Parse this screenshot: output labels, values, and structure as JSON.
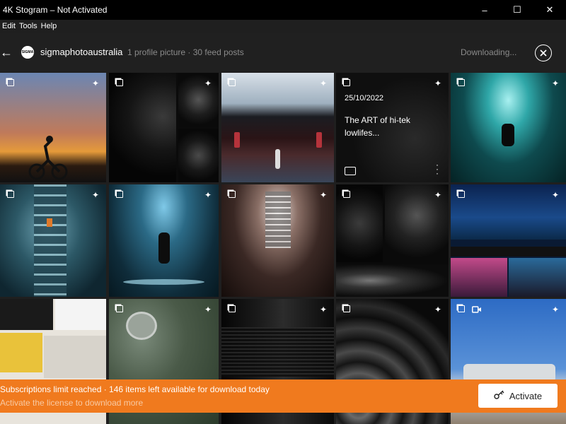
{
  "window": {
    "title": "4K Stogram – Not Activated",
    "minimize": "–",
    "maximize": "☐",
    "close": "✕"
  },
  "menu": [
    "Edit",
    "Tools",
    "Help"
  ],
  "header": {
    "back": "←",
    "avatar_text": "SIGMA",
    "username": "sigmaphotoaustralia",
    "stats": "1 profile picture · 30 feed posts",
    "status": "Downloading..."
  },
  "post": {
    "date": "25/10/2022",
    "caption": "The ART of hi-tek lowlifes..."
  },
  "banner": {
    "message": "Subscriptions limit reached · 146 items left available for download today",
    "hint": "Activate the license to download more",
    "button_label": "Activate"
  },
  "colors": {
    "accent": "#f07a1e",
    "background": "#1f1f1f",
    "titlebar": "#000000"
  },
  "icons": {
    "multi_post": "multi-image-icon",
    "sparkle": "sparkle-icon",
    "video": "video-icon",
    "folder": "folder-icon",
    "more": "kebab-icon",
    "key": "key-icon"
  }
}
